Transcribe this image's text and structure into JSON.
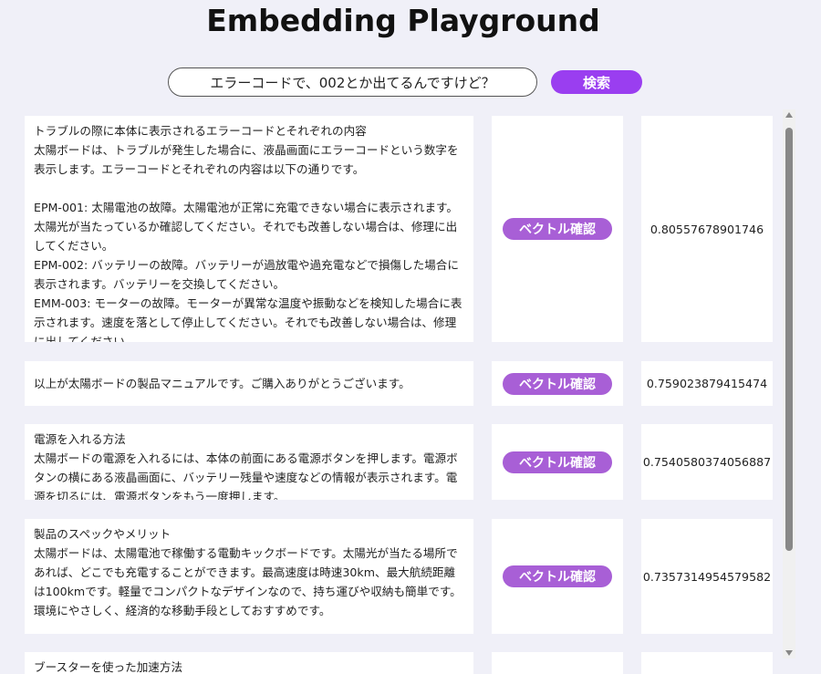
{
  "page_title": "Embedding Playground",
  "search": {
    "value": "エラーコードで、002とか出てるんですけど？",
    "button_label": "検索"
  },
  "vector_button_label": "ベクトル確認",
  "results": [
    {
      "text": "トラブルの際に本体に表示されるエラーコードとそれぞれの内容\n太陽ボードは、トラブルが発生した場合に、液晶画面にエラーコードという数字を表示します。エラーコードとそれぞれの内容は以下の通りです。\n\nEPM-001: 太陽電池の故障。太陽電池が正常に充電できない場合に表示されます。太陽光が当たっているか確認してください。それでも改善しない場合は、修理に出してください。\nEPM-002: バッテリーの故障。バッテリーが過放電や過充電などで損傷した場合に表示されます。バッテリーを交換してください。\nEMM-003: モーターの故障。モーターが異常な温度や振動などを検知した場合に表示されます。速度を落として停止してください。それでも改善しない場合は、修理に出してください。",
      "score": "0.80557678901746"
    },
    {
      "text": "以上が太陽ボードの製品マニュアルです。ご購入ありがとうございます。",
      "score": "0.759023879415474"
    },
    {
      "text": "電源を入れる方法\n太陽ボードの電源を入れるには、本体の前面にある電源ボタンを押します。電源ボタンの横にある液晶画面に、バッテリー残量や速度などの情報が表示されます。電源を切るには、電源ボタンをもう一度押します。",
      "score": "0.7540580374056887"
    },
    {
      "text": "製品のスペックやメリット\n太陽ボードは、太陽電池で稼働する電動キックボードです。太陽光が当たる場所であれば、どこでも充電することができます。最高速度は時速30km、最大航続距離は100kmです。軽量でコンパクトなデザインなので、持ち運びや収納も簡単です。環境にやさしく、経済的な移動手段としておすすめです。",
      "score": "0.7357314954579582"
    },
    {
      "text": "ブースターを使った加速方法",
      "score": ""
    }
  ]
}
